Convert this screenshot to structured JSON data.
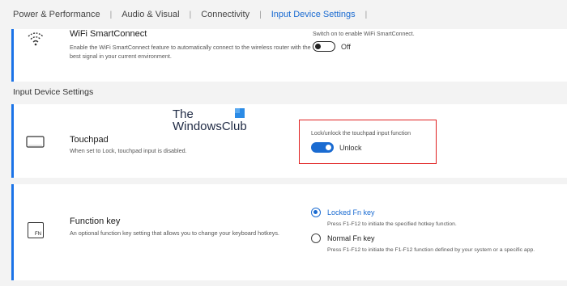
{
  "tabs": [
    {
      "label": "Power & Performance",
      "active": false
    },
    {
      "label": "Audio & Visual",
      "active": false
    },
    {
      "label": "Connectivity",
      "active": false
    },
    {
      "label": "Input Device Settings",
      "active": true
    }
  ],
  "wifi": {
    "title": "WiFi SmartConnect",
    "description": "Enable the WiFi SmartConnect feature to automatically connect to the wireless router with the best signal in your current environment.",
    "hint": "Switch on to enable WiFi SmartConnect.",
    "state": "Off",
    "icon": "wifi-icon"
  },
  "section": {
    "label": "Input Device Settings"
  },
  "touchpad": {
    "title": "Touchpad",
    "description": "When set to Lock, touchpad input is disabled.",
    "hint": "Lock/unlock the touchpad input function",
    "state": "Unlock",
    "icon": "touchpad-icon"
  },
  "function_key": {
    "title": "Function key",
    "description": "An optional function key setting that allows you to change your keyboard hotkeys.",
    "icon_text": "FN",
    "options": [
      {
        "label": "Locked Fn key",
        "description": "Press F1-F12 to initiate the specified hotkey function.",
        "selected": true
      },
      {
        "label": "Normal Fn key",
        "description": "Press F1-F12 to initiate the F1-F12 function defined by your system or a specific app.",
        "selected": false
      }
    ]
  },
  "watermark": {
    "line1": "The",
    "line2": "WindowsClub"
  },
  "colors": {
    "accent": "#1a6bd1",
    "highlight": "#e02020"
  }
}
